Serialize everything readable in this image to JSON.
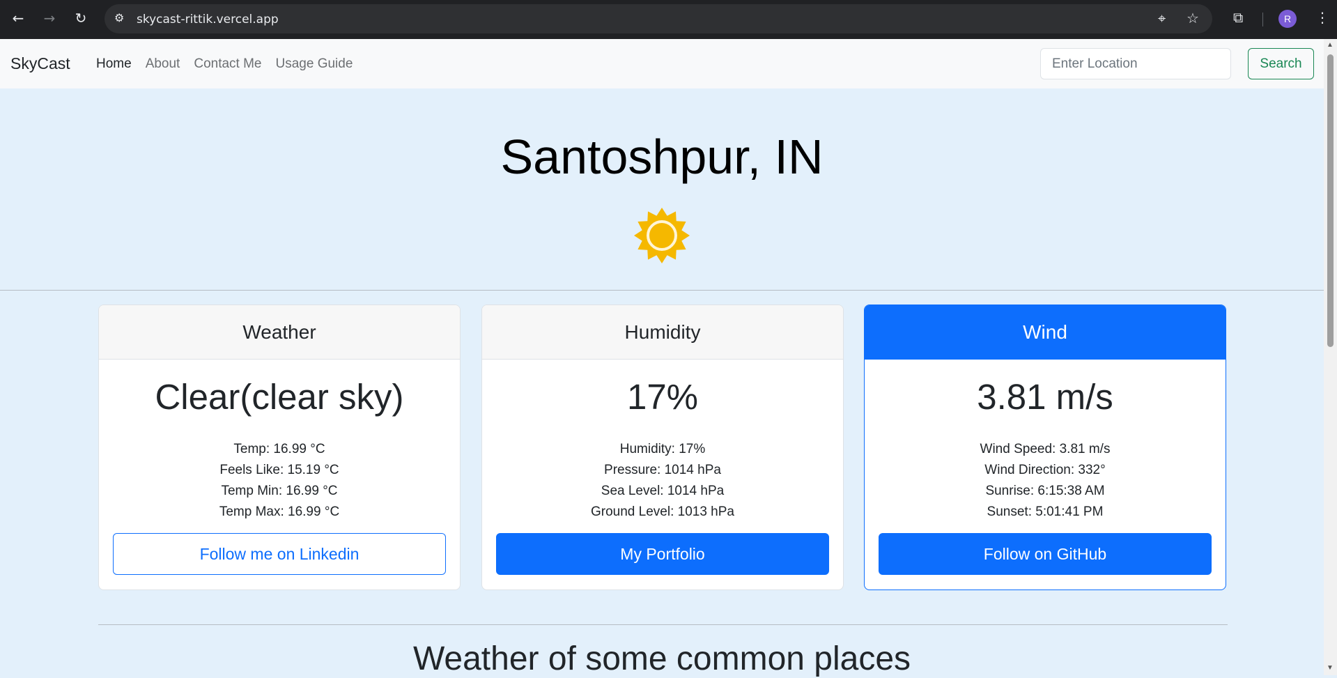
{
  "browser": {
    "url": "skycast-rittik.vercel.app",
    "profile_initial": "R",
    "icons": [
      "back-icon",
      "forward-icon",
      "reload-icon",
      "site-info-icon",
      "location-icon",
      "star-icon",
      "extensions-icon",
      "more-icon"
    ]
  },
  "navbar": {
    "brand": "SkyCast",
    "links": [
      "Home",
      "About",
      "Contact Me",
      "Usage Guide"
    ],
    "active_link": "Home",
    "search_placeholder": "Enter Location",
    "search_button": "Search"
  },
  "hero": {
    "city": "Santoshpur, IN",
    "weather_icon": "sun-icon"
  },
  "cards": {
    "weather": {
      "title": "Weather",
      "value": "Clear(clear sky)",
      "details": [
        "Temp: 16.99 °C",
        "Feels Like: 15.19 °C",
        "Temp Min: 16.99 °C",
        "Temp Max: 16.99 °C"
      ],
      "button": "Follow me on Linkedin"
    },
    "humidity": {
      "title": "Humidity",
      "value": "17%",
      "details": [
        "Humidity: 17%",
        "Pressure: 1014 hPa",
        "Sea Level: 1014 hPa",
        "Ground Level: 1013 hPa"
      ],
      "button": "My Portfolio"
    },
    "wind": {
      "title": "Wind",
      "value": "3.81 m/s",
      "details": [
        "Wind Speed: 3.81 m/s",
        "Wind Direction: 332°",
        "Sunrise: 6:15:38 AM",
        "Sunset: 5:01:41 PM"
      ],
      "button": "Follow on GitHub"
    }
  },
  "section": {
    "title": "Weather of some common places"
  },
  "colors": {
    "primary": "#0d6efd",
    "success": "#198754",
    "page_bg": "#e3f0fb",
    "sun": "#f5b800"
  }
}
